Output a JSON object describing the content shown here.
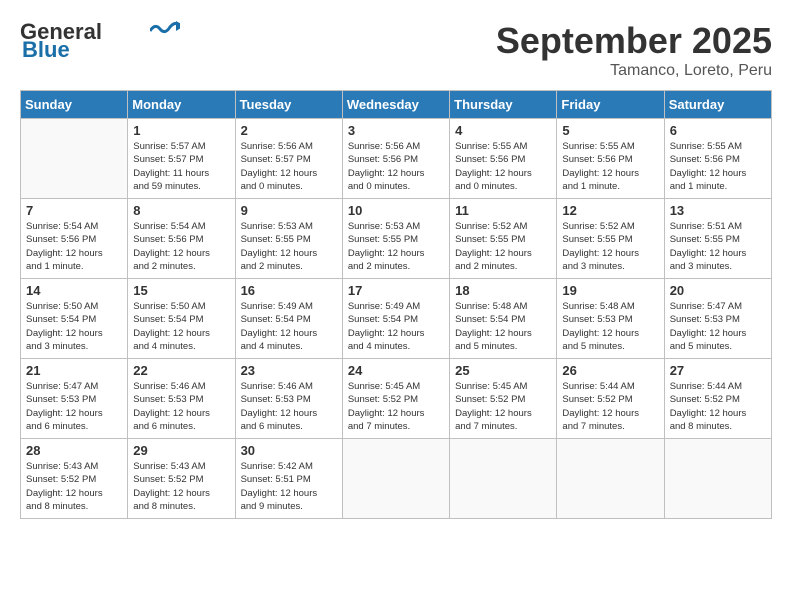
{
  "header": {
    "logo_general": "General",
    "logo_blue": "Blue",
    "month": "September 2025",
    "location": "Tamanco, Loreto, Peru"
  },
  "weekdays": [
    "Sunday",
    "Monday",
    "Tuesday",
    "Wednesday",
    "Thursday",
    "Friday",
    "Saturday"
  ],
  "weeks": [
    [
      {
        "day": "",
        "info": ""
      },
      {
        "day": "1",
        "info": "Sunrise: 5:57 AM\nSunset: 5:57 PM\nDaylight: 11 hours\nand 59 minutes."
      },
      {
        "day": "2",
        "info": "Sunrise: 5:56 AM\nSunset: 5:57 PM\nDaylight: 12 hours\nand 0 minutes."
      },
      {
        "day": "3",
        "info": "Sunrise: 5:56 AM\nSunset: 5:56 PM\nDaylight: 12 hours\nand 0 minutes."
      },
      {
        "day": "4",
        "info": "Sunrise: 5:55 AM\nSunset: 5:56 PM\nDaylight: 12 hours\nand 0 minutes."
      },
      {
        "day": "5",
        "info": "Sunrise: 5:55 AM\nSunset: 5:56 PM\nDaylight: 12 hours\nand 1 minute."
      },
      {
        "day": "6",
        "info": "Sunrise: 5:55 AM\nSunset: 5:56 PM\nDaylight: 12 hours\nand 1 minute."
      }
    ],
    [
      {
        "day": "7",
        "info": "Sunrise: 5:54 AM\nSunset: 5:56 PM\nDaylight: 12 hours\nand 1 minute."
      },
      {
        "day": "8",
        "info": "Sunrise: 5:54 AM\nSunset: 5:56 PM\nDaylight: 12 hours\nand 2 minutes."
      },
      {
        "day": "9",
        "info": "Sunrise: 5:53 AM\nSunset: 5:55 PM\nDaylight: 12 hours\nand 2 minutes."
      },
      {
        "day": "10",
        "info": "Sunrise: 5:53 AM\nSunset: 5:55 PM\nDaylight: 12 hours\nand 2 minutes."
      },
      {
        "day": "11",
        "info": "Sunrise: 5:52 AM\nSunset: 5:55 PM\nDaylight: 12 hours\nand 2 minutes."
      },
      {
        "day": "12",
        "info": "Sunrise: 5:52 AM\nSunset: 5:55 PM\nDaylight: 12 hours\nand 3 minutes."
      },
      {
        "day": "13",
        "info": "Sunrise: 5:51 AM\nSunset: 5:55 PM\nDaylight: 12 hours\nand 3 minutes."
      }
    ],
    [
      {
        "day": "14",
        "info": "Sunrise: 5:50 AM\nSunset: 5:54 PM\nDaylight: 12 hours\nand 3 minutes."
      },
      {
        "day": "15",
        "info": "Sunrise: 5:50 AM\nSunset: 5:54 PM\nDaylight: 12 hours\nand 4 minutes."
      },
      {
        "day": "16",
        "info": "Sunrise: 5:49 AM\nSunset: 5:54 PM\nDaylight: 12 hours\nand 4 minutes."
      },
      {
        "day": "17",
        "info": "Sunrise: 5:49 AM\nSunset: 5:54 PM\nDaylight: 12 hours\nand 4 minutes."
      },
      {
        "day": "18",
        "info": "Sunrise: 5:48 AM\nSunset: 5:54 PM\nDaylight: 12 hours\nand 5 minutes."
      },
      {
        "day": "19",
        "info": "Sunrise: 5:48 AM\nSunset: 5:53 PM\nDaylight: 12 hours\nand 5 minutes."
      },
      {
        "day": "20",
        "info": "Sunrise: 5:47 AM\nSunset: 5:53 PM\nDaylight: 12 hours\nand 5 minutes."
      }
    ],
    [
      {
        "day": "21",
        "info": "Sunrise: 5:47 AM\nSunset: 5:53 PM\nDaylight: 12 hours\nand 6 minutes."
      },
      {
        "day": "22",
        "info": "Sunrise: 5:46 AM\nSunset: 5:53 PM\nDaylight: 12 hours\nand 6 minutes."
      },
      {
        "day": "23",
        "info": "Sunrise: 5:46 AM\nSunset: 5:53 PM\nDaylight: 12 hours\nand 6 minutes."
      },
      {
        "day": "24",
        "info": "Sunrise: 5:45 AM\nSunset: 5:52 PM\nDaylight: 12 hours\nand 7 minutes."
      },
      {
        "day": "25",
        "info": "Sunrise: 5:45 AM\nSunset: 5:52 PM\nDaylight: 12 hours\nand 7 minutes."
      },
      {
        "day": "26",
        "info": "Sunrise: 5:44 AM\nSunset: 5:52 PM\nDaylight: 12 hours\nand 7 minutes."
      },
      {
        "day": "27",
        "info": "Sunrise: 5:44 AM\nSunset: 5:52 PM\nDaylight: 12 hours\nand 8 minutes."
      }
    ],
    [
      {
        "day": "28",
        "info": "Sunrise: 5:43 AM\nSunset: 5:52 PM\nDaylight: 12 hours\nand 8 minutes."
      },
      {
        "day": "29",
        "info": "Sunrise: 5:43 AM\nSunset: 5:52 PM\nDaylight: 12 hours\nand 8 minutes."
      },
      {
        "day": "30",
        "info": "Sunrise: 5:42 AM\nSunset: 5:51 PM\nDaylight: 12 hours\nand 9 minutes."
      },
      {
        "day": "",
        "info": ""
      },
      {
        "day": "",
        "info": ""
      },
      {
        "day": "",
        "info": ""
      },
      {
        "day": "",
        "info": ""
      }
    ]
  ]
}
